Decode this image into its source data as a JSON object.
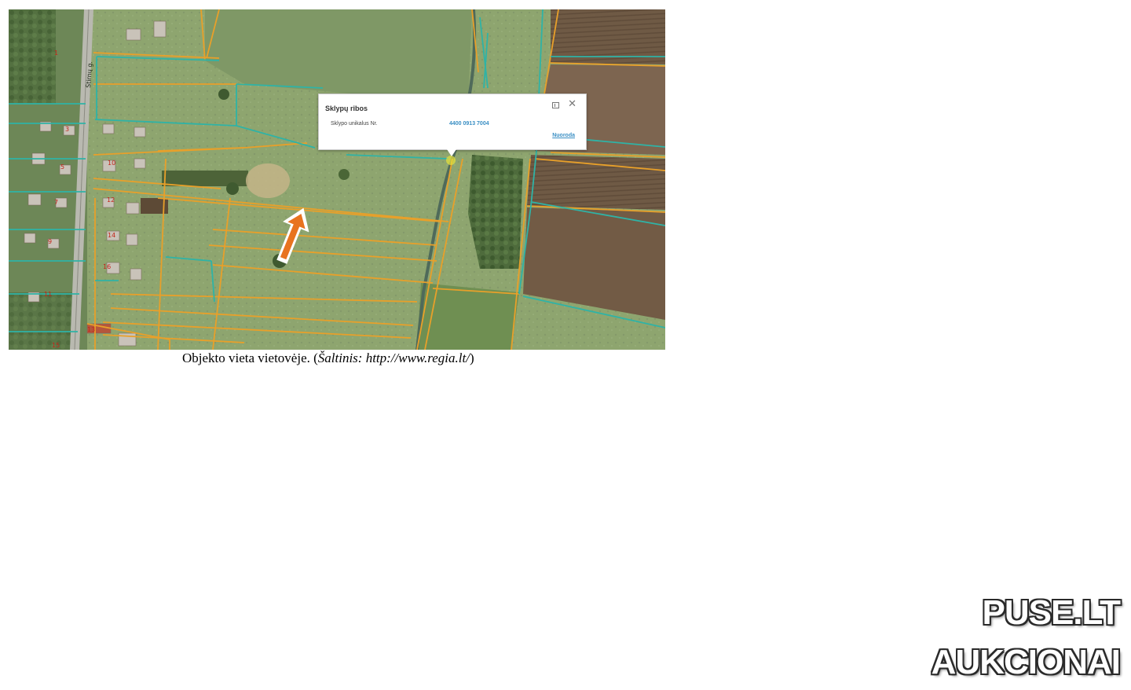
{
  "map": {
    "street_label": "Stirnų g.",
    "plot_numbers": [
      "1",
      "3",
      "5",
      "7",
      "9",
      "10",
      "11",
      "12",
      "13",
      "14",
      "15",
      "16"
    ],
    "colors": {
      "parcel_boundary": "#e8a02a",
      "cadastral_boundary": "#2fb3a6",
      "arrow": "#e8731f",
      "field": "#8aa36a",
      "plowed": "#7a5e46"
    }
  },
  "popup": {
    "title": "Sklypų ribos",
    "row_label": "Sklypo unikalus Nr.",
    "row_value": "4400 0913 7004",
    "link": "Nuoroda",
    "maximize_icon": "maximize-icon",
    "close_icon": "close-icon",
    "close_glyph": "✕"
  },
  "caption": {
    "prefix": "Objekto vieta vietovėje. (",
    "source": "Šaltinis: http://www.regia.lt/",
    "suffix": ")"
  },
  "watermark": {
    "line1": "PUSE.LT",
    "line2": "AUKCIONAI"
  }
}
